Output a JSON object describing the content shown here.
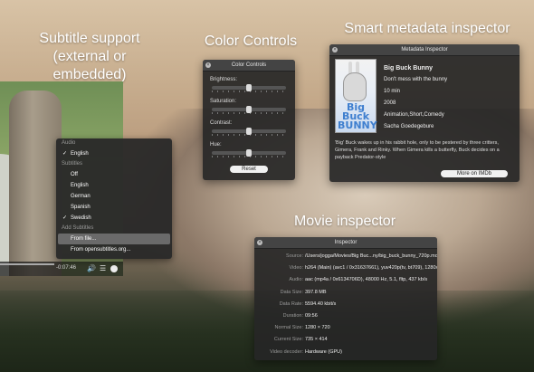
{
  "captions": {
    "subtitle": [
      "Subtitle support",
      "(external or embedded)"
    ],
    "color": "Color Controls",
    "metadata": "Smart metadata inspector",
    "movie": "Movie inspector"
  },
  "player": {
    "elapsed": "-0:07:46"
  },
  "audio_menu": {
    "audio_header": "Audio",
    "audio_items": [
      {
        "label": "English",
        "checked": true
      }
    ],
    "subtitles_header": "Subtitles",
    "subtitle_items": [
      {
        "label": "Off",
        "checked": false
      },
      {
        "label": "English",
        "checked": false
      },
      {
        "label": "German",
        "checked": false
      },
      {
        "label": "Spanish",
        "checked": false
      },
      {
        "label": "Swedish",
        "checked": true
      }
    ],
    "add_header": "Add Subtitles",
    "add_items": [
      {
        "label": "From file...",
        "highlighted": true
      },
      {
        "label": "From opensubtitles.org...",
        "highlighted": false
      }
    ]
  },
  "color_controls": {
    "title": "Color Controls",
    "brightness_label": "Brightness:",
    "saturation_label": "Saturation:",
    "contrast_label": "Contrast:",
    "hue_label": "Hue:",
    "brightness": 0.5,
    "saturation": 0.5,
    "contrast": 0.5,
    "hue": 0.5,
    "reset_label": "Reset"
  },
  "metadata": {
    "title": "Metadata Inspector",
    "poster_text": "Big Buck BUNNY",
    "movie_title": "Big Buck Bunny",
    "tagline": "Don't mess with the bunny",
    "runtime": "10 min",
    "year": "2008",
    "genres": "Animation,Short,Comedy",
    "director": "Sacha Goedegebure",
    "description": "'Big' Buck wakes up in his rabbit hole, only to be pestered by three critters, Gimera, Frank and Rinky. When Gimera kills a butterfly, Buck decides on a payback Predator-style",
    "imdb_label": "More on IMDb"
  },
  "inspector": {
    "title": "Inspector",
    "rows": [
      {
        "key": "Source:",
        "value": "/Users/jogga/Movies/Big Buc...ny/big_buck_bunny_720p.mov"
      },
      {
        "key": "Video:",
        "value": "h264 (Main) (avc1 / 0x31637661), yuv420p(tv, bt709), 1280x..."
      },
      {
        "key": "Audio:",
        "value": "aac (mp4a / 0x6134706D), 48000 Hz, 5.1, fltp, 437 kb/s"
      },
      {
        "key": "Data Size:",
        "value": "397.8 MB"
      },
      {
        "key": "Data Rate:",
        "value": "5594.40 kbit/s"
      },
      {
        "key": "Duration:",
        "value": "09:56"
      },
      {
        "key": "Normal Size:",
        "value": "1280 × 720"
      },
      {
        "key": "Current Size:",
        "value": "735 × 414"
      },
      {
        "key": "Video decoder:",
        "value": "Hardware (GPU)"
      }
    ]
  }
}
